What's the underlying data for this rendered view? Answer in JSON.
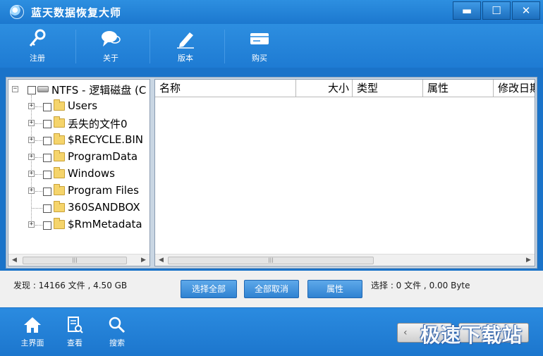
{
  "window": {
    "title": "蓝天数据恢复大师",
    "minimize": "▬",
    "maximize": "☐",
    "close": "✕"
  },
  "toolbar": {
    "items": [
      {
        "label": "注册",
        "icon": "key-icon"
      },
      {
        "label": "关于",
        "icon": "chat-bubble-icon"
      },
      {
        "label": "版本",
        "icon": "pencil-icon"
      },
      {
        "label": "购买",
        "icon": "card-icon"
      }
    ]
  },
  "tree": {
    "root": "NTFS - 逻辑磁盘 (C",
    "items": [
      {
        "label": "Users",
        "expandable": true
      },
      {
        "label": "丢失的文件0",
        "expandable": true
      },
      {
        "label": "$RECYCLE.BIN",
        "expandable": true
      },
      {
        "label": "ProgramData",
        "expandable": true
      },
      {
        "label": "Windows",
        "expandable": true
      },
      {
        "label": "Program Files",
        "expandable": true
      },
      {
        "label": "360SANDBOX",
        "expandable": false
      },
      {
        "label": "$RmMetadata",
        "expandable": true
      }
    ]
  },
  "list": {
    "columns": [
      "名称",
      "大小",
      "类型",
      "属性",
      "修改日期"
    ]
  },
  "status": {
    "found": "发现 : 14166 文件 , 4.50 GB",
    "selected": "选择 : 0 文件 , 0.00 Byte"
  },
  "actions": {
    "select_all": "选择全部",
    "deselect_all": "全部取消",
    "properties": "属性"
  },
  "nav": {
    "items": [
      {
        "label": "主界面",
        "icon": "home-icon"
      },
      {
        "label": "查看",
        "icon": "document-search-icon"
      },
      {
        "label": "搜索",
        "icon": "magnifier-icon"
      }
    ],
    "back": "‹"
  },
  "watermark": "极速下载站"
}
